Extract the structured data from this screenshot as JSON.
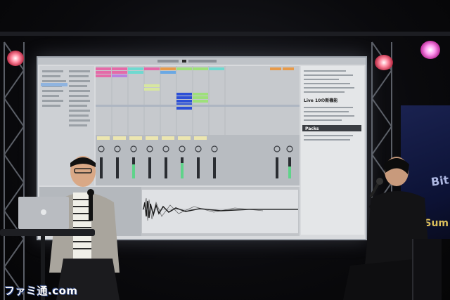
{
  "scene": {
    "description_free": true,
    "screen_app": "Ableton Live session view projected on stage screen",
    "panel_heading_1": "Live 10の新機能",
    "panel_heading_2": "Packs",
    "watermark": "ファミ通.com",
    "banner_text_1": "Bit",
    "banner_text_2": "Sum"
  },
  "colors": {
    "stage_dark": "#07070a",
    "screen_bg": "#d8dadd",
    "clip_pink": "#e46aa8",
    "clip_green": "#9ee07a",
    "clip_cyan": "#6fd9d0",
    "clip_orange": "#e79a4a",
    "clip_blue_selected": "#2c4fd6",
    "stage_light_red": "#ff6a8a",
    "stage_light_pink": "#ff7ae0"
  }
}
